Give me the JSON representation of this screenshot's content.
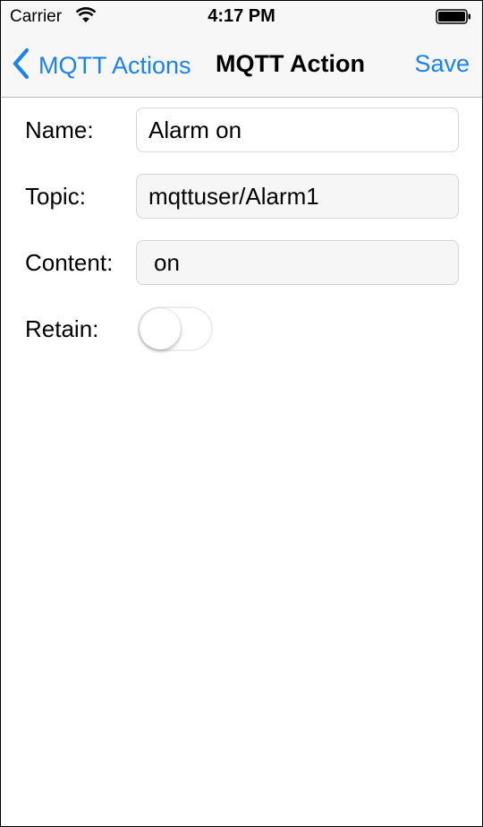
{
  "status_bar": {
    "carrier": "Carrier",
    "time": "4:17 PM",
    "icons": [
      "wifi-icon",
      "battery-icon"
    ]
  },
  "nav": {
    "back_label": "MQTT Actions",
    "title": "MQTT Action",
    "save_label": "Save",
    "accent_color": "#1a82f5"
  },
  "form": {
    "name_label": "Name:",
    "name_value": "Alarm on",
    "topic_label": "Topic:",
    "topic_value": "mqttuser/Alarm1",
    "content_label": "Content:",
    "content_value": "on",
    "retain_label": "Retain:",
    "retain_on": false
  }
}
